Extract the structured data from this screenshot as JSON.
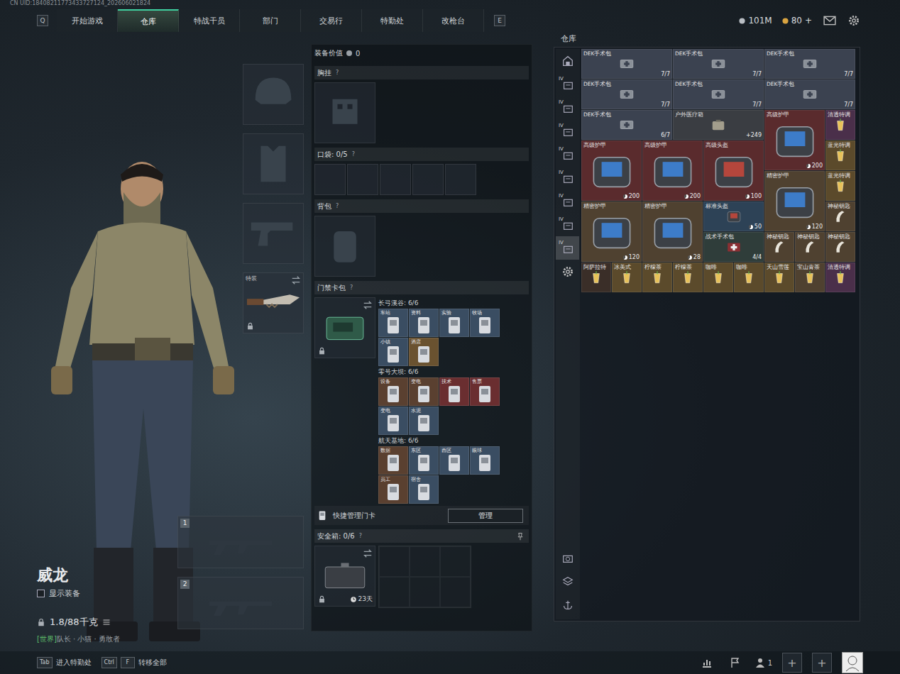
{
  "header": {
    "uid": "CN UID:18408211773433727124_202606021824"
  },
  "nav": {
    "prev_key": "Q",
    "next_key": "E",
    "tabs": [
      {
        "label": "开始游戏",
        "selected": false
      },
      {
        "label": "仓库",
        "selected": true
      },
      {
        "label": "特战干员",
        "selected": false
      },
      {
        "label": "部门",
        "selected": false
      },
      {
        "label": "交易行",
        "selected": false
      },
      {
        "label": "特勤处",
        "selected": false
      },
      {
        "label": "改枪台",
        "selected": false
      }
    ]
  },
  "currency": [
    {
      "kind": "coin",
      "value": "101M"
    },
    {
      "kind": "bond",
      "value": "80"
    }
  ],
  "currency_add": "+",
  "operator": {
    "name": "威龙",
    "show_gear": {
      "label": "显示装备",
      "checked": false
    },
    "weight": "1.8/88千克",
    "tag_prefix": "[世界]",
    "tag": "队长 · 小猫 · 勇敢者"
  },
  "gear_slots": [
    {
      "kind": "helmet"
    },
    {
      "kind": "armor"
    },
    {
      "kind": "pistol"
    },
    {
      "kind": "knife",
      "label": "特装",
      "locked": true
    }
  ],
  "weapon_slots": [
    {
      "number": "1"
    },
    {
      "number": "2"
    }
  ],
  "loadout": {
    "value_label": "装备价值",
    "value": "0",
    "chest": {
      "title": "胸挂",
      "help": "?"
    },
    "pockets": {
      "title": "口袋: 0/5",
      "help": "?",
      "slots": [
        {
          "filled": false
        },
        {
          "filled": false
        },
        {
          "filled": false
        },
        {
          "filled": false
        },
        {
          "filled": false
        }
      ]
    },
    "backpack": {
      "title": "背包",
      "help": "?"
    },
    "keycards": {
      "title": "门禁卡包",
      "help": "?",
      "locked": true,
      "groups": [
        {
          "title": "长弓溪谷: 6/6",
          "cards": [
            {
              "label": "车站",
              "color": "#3a4d62"
            },
            {
              "label": "资料",
              "color": "#3a4d62"
            },
            {
              "label": "实验",
              "color": "#3a4d62"
            },
            {
              "label": "牧场",
              "color": "#3a4d62"
            },
            {
              "label": "小镇",
              "color": "#3a4d62"
            },
            {
              "label": "酒店",
              "color": "#6a5230"
            }
          ]
        },
        {
          "title": "零号大坝: 6/6",
          "cards": [
            {
              "label": "设备",
              "color": "#5a4030"
            },
            {
              "label": "变电",
              "color": "#5a4030"
            },
            {
              "label": "技术",
              "color": "#6a2e30"
            },
            {
              "label": "售票",
              "color": "#6a2e30"
            },
            {
              "label": "变电",
              "color": "#3a4d62"
            },
            {
              "label": "水泥",
              "color": "#3a4d62"
            }
          ]
        },
        {
          "title": "航天基地: 6/6",
          "cards": [
            {
              "label": "数据",
              "color": "#5a4030"
            },
            {
              "label": "东区",
              "color": "#3a4d62"
            },
            {
              "label": "西区",
              "color": "#3a4d62"
            },
            {
              "label": "眼球",
              "color": "#3a4d62"
            },
            {
              "label": "员工",
              "color": "#5a4030"
            },
            {
              "label": "宿舍",
              "color": "#3a4d62"
            }
          ]
        }
      ]
    },
    "quick_manage": {
      "label": "快捷管理门卡",
      "button": "管理"
    },
    "safe": {
      "title": "安全箱: 0/6",
      "help": "?",
      "time": "23天",
      "locked": true,
      "cells": [
        {
          "filled": false
        },
        {
          "filled": false
        },
        {
          "filled": false
        },
        {
          "filled": false
        },
        {
          "filled": false
        },
        {
          "filled": false
        }
      ]
    }
  },
  "warehouse": {
    "title": "仓库",
    "tabs": [
      {
        "kind": "home",
        "selected": false
      },
      {
        "kind": "category",
        "badge": "IV",
        "selected": false
      },
      {
        "kind": "category",
        "badge": "IV",
        "selected": false
      },
      {
        "kind": "category",
        "badge": "IV",
        "selected": false
      },
      {
        "kind": "category",
        "badge": "IV",
        "selected": false
      },
      {
        "kind": "category",
        "badge": "IV",
        "selected": false
      },
      {
        "kind": "category",
        "badge": "IV",
        "selected": false
      },
      {
        "kind": "category",
        "badge": "IV",
        "selected": false
      },
      {
        "kind": "category",
        "badge": "IV",
        "selected": true
      },
      {
        "kind": "settings",
        "selected": false
      }
    ],
    "items": [
      {
        "label": "DEK手术包",
        "count": "7/7",
        "kind": "kit",
        "color": "#3b4250"
      },
      {
        "label": "DEK手术包",
        "count": "7/7",
        "kind": "kit",
        "color": "#3b4250"
      },
      {
        "label": "DEK手术包",
        "count": "7/7",
        "kind": "kit",
        "color": "#3b4250"
      },
      {
        "label": "DEK手术包",
        "count": "7/7",
        "kind": "kit",
        "color": "#3b4250"
      },
      {
        "label": "DEK手术包",
        "count": "7/7",
        "kind": "kit",
        "color": "#3b4250"
      },
      {
        "label": "DEK手术包",
        "count": "7/7",
        "kind": "kit",
        "color": "#3b4250"
      },
      {
        "label": "DEK手术包",
        "count": "6/7",
        "kind": "kit",
        "color": "#3b4250"
      },
      {
        "label": "户外医疗箱",
        "count": "+249",
        "kind": "medbox",
        "color": "#3a3d42"
      },
      {
        "label": "高级护甲",
        "count": "200",
        "kind": "armor",
        "color": "#5a2b2d"
      },
      {
        "label": "清透特调",
        "kind": "drink",
        "color": "#4a2f4a"
      },
      {
        "label": "高级护甲",
        "count": "200",
        "kind": "armor",
        "color": "#5a2b2d"
      },
      {
        "label": "高级护甲",
        "count": "200",
        "kind": "armor",
        "color": "#5a2b2d"
      },
      {
        "label": "高级头盔",
        "count": "100",
        "kind": "helmet",
        "color": "#5a2b2d"
      },
      {
        "label": "蓝光特调",
        "kind": "drink",
        "color": "#5b4a2b"
      },
      {
        "label": "精密护甲",
        "count": "120",
        "kind": "armor",
        "color": "#4f4130"
      },
      {
        "label": "蓝光特调",
        "kind": "drink",
        "color": "#5b4a2b"
      },
      {
        "label": "精密护甲",
        "count": "120",
        "kind": "armor",
        "color": "#4f4130"
      },
      {
        "label": "精密护甲",
        "count": "28",
        "kind": "armor",
        "color": "#4f4130"
      },
      {
        "label": "标准头盔",
        "count": "50",
        "kind": "helmet",
        "color": "#2d4256"
      },
      {
        "label": "神秘钥匙",
        "kind": "key",
        "color": "#4f4130"
      },
      {
        "label": "战术手术包",
        "count": "4/4",
        "kind": "surgery",
        "color": "#2f3d3a"
      },
      {
        "label": "神秘钥匙",
        "kind": "key",
        "color": "#4f4130"
      },
      {
        "label": "神秘钥匙",
        "kind": "key",
        "color": "#4f4130"
      },
      {
        "label": "神秘钥匙",
        "kind": "key",
        "color": "#4f4130"
      },
      {
        "label": "阿萨拉特",
        "kind": "drink",
        "color": "#3a2e28"
      },
      {
        "label": "冰美式",
        "kind": "drink",
        "color": "#5b4a2b"
      },
      {
        "label": "柠檬茶",
        "kind": "drink",
        "color": "#5b4a2b"
      },
      {
        "label": "柠檬茶",
        "kind": "drink",
        "color": "#5b4a2b"
      },
      {
        "label": "咖啡",
        "kind": "drink",
        "color": "#5b4a2b"
      },
      {
        "label": "咖啡",
        "kind": "drink",
        "color": "#5b4a2b"
      },
      {
        "label": "天山雪莲",
        "kind": "drink",
        "color": "#5b4a2b"
      },
      {
        "label": "宝山青茶",
        "kind": "drink",
        "color": "#4f4130"
      },
      {
        "label": "清透特调",
        "kind": "drink",
        "color": "#4a2f4a"
      }
    ]
  },
  "bottom": {
    "hints": [
      {
        "keys": [
          "Tab"
        ],
        "label": "进入特勤处"
      },
      {
        "keys": [
          "Ctrl",
          "F"
        ],
        "label": "转移全部"
      }
    ],
    "party_count": "1",
    "add_buttons": [
      "+",
      "+"
    ]
  }
}
